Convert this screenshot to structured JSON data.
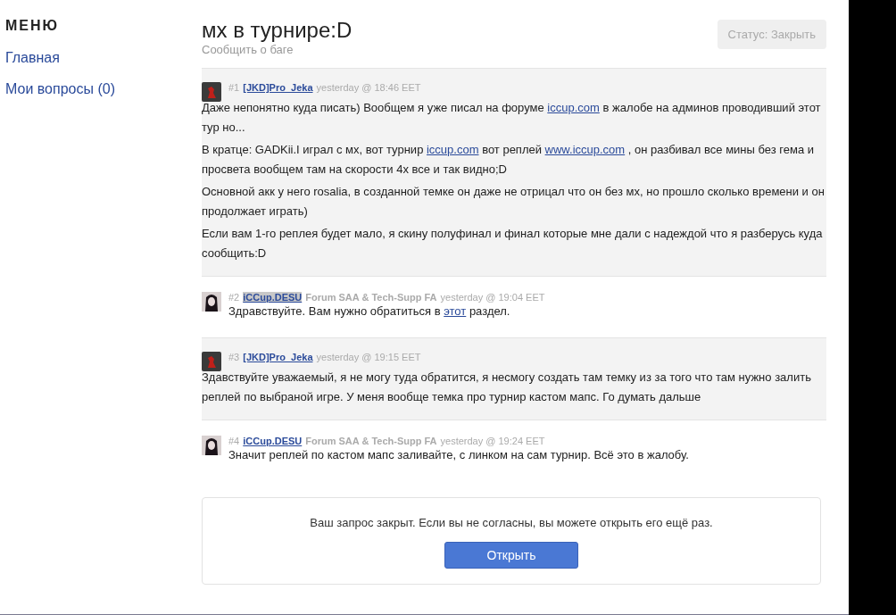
{
  "sidebar": {
    "heading": "МЕНЮ",
    "items": [
      {
        "label": "Главная"
      },
      {
        "label": "Мои вопросы (0)"
      }
    ]
  },
  "ticket": {
    "title": "мх в турнире:D",
    "subtitle": "Сообщить о баге",
    "status_button": "Статус: Закрыть"
  },
  "posts": [
    {
      "kind": "member",
      "number": "#1",
      "author": "[JKD]Pro_Jeka",
      "author_selected": false,
      "time": "yesterday @ 18:46 EET",
      "paragraphs": [
        [
          {
            "kind": "text",
            "text": "Даже непонятно куда писать) Вообщем я уже писал на форуме "
          },
          {
            "kind": "link",
            "text": "iccup.com"
          },
          {
            "kind": "text",
            "text": " в жалобе на админов проводивший этот тур но..."
          }
        ],
        [
          {
            "kind": "text",
            "text": "В кратце: GADKii.I играл с мх, вот турнир "
          },
          {
            "kind": "link",
            "text": "iccup.com"
          },
          {
            "kind": "text",
            "text": " вот реплей "
          },
          {
            "kind": "link",
            "text": "www.iccup.com"
          },
          {
            "kind": "text",
            "text": " , он разбивал все мины без гема и просвета вообщем там на скорости 4х все и так видно;D"
          }
        ],
        [
          {
            "kind": "text",
            "text": "Основной акк у него rosalia, в созданной темке он даже не отрицал что он без мх, но прошло сколько времени и он продолжает играть)"
          }
        ],
        [
          {
            "kind": "text",
            "text": "Если вам 1-го реплея будет мало, я скину полуфинал и финал которые мне дали с надеждой что я разберусь куда сообщить:D"
          }
        ]
      ]
    },
    {
      "kind": "staff",
      "number": "#2",
      "author": "iCCup.DESU",
      "author_selected": true,
      "role": "Forum SAA & Tech-Supp FA",
      "time": "yesterday @ 19:04 EET",
      "paragraphs": [
        [
          {
            "kind": "text",
            "text": "Здравствуйте. Вам нужно обратиться в "
          },
          {
            "kind": "link",
            "text": "этот"
          },
          {
            "kind": "text",
            "text": " раздел."
          }
        ]
      ]
    },
    {
      "kind": "member",
      "number": "#3",
      "author": "[JKD]Pro_Jeka",
      "author_selected": false,
      "time": "yesterday @ 19:15 EET",
      "paragraphs": [
        [
          {
            "kind": "text",
            "text": "Здавствуйте уважаемый, я не могу туда обратится, я несмогу создать там темку из за того что там нужно залить реплей по выбраной игре. У меня вообще темка про турнир кастом мапс. Го думать дальше"
          }
        ]
      ]
    },
    {
      "kind": "staff",
      "number": "#4",
      "author": "iCCup.DESU",
      "author_selected": false,
      "role": "Forum SAA & Tech-Supp FA",
      "time": "yesterday @ 19:24 EET",
      "paragraphs": [
        [
          {
            "kind": "text",
            "text": "Значит реплей по кастом мапс заливайте, с линком на сам турнир. Всё это в жалобу."
          }
        ]
      ]
    }
  ],
  "closed_notice": {
    "message": "Ваш запрос закрыт. Если вы не согласны, вы можете открыть его ещё раз.",
    "button": "Открыть"
  }
}
